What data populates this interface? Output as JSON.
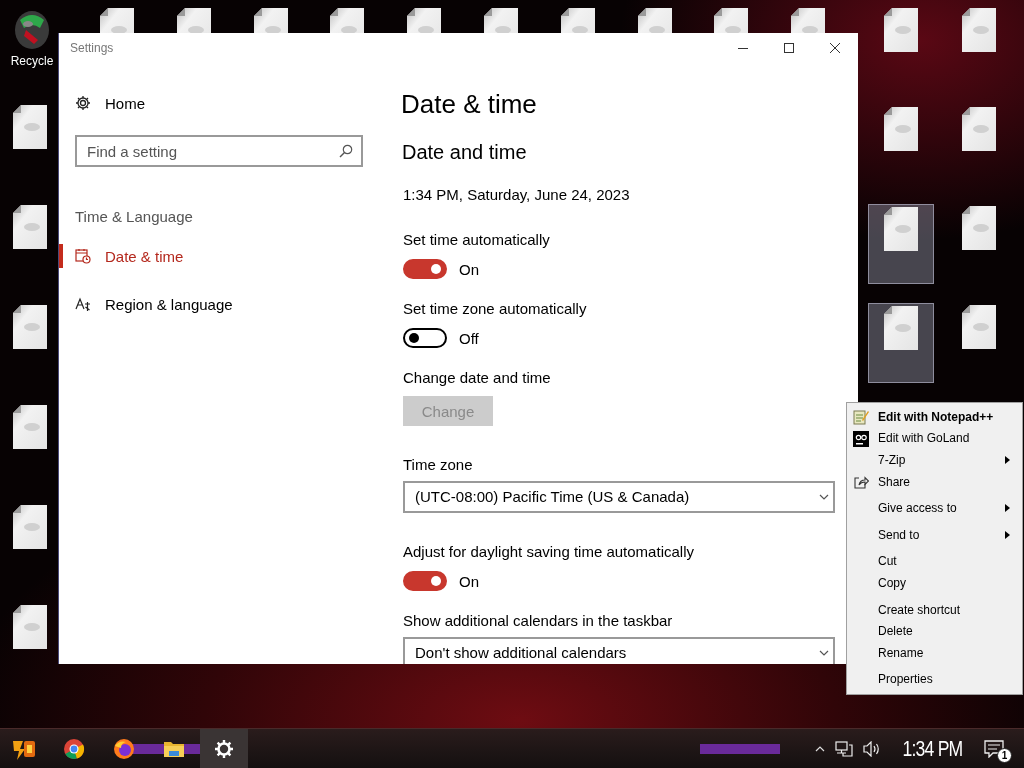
{
  "desktop": {
    "recycle_bin": {
      "label": "Recycle"
    },
    "top_row": [
      {
        "selected": false
      },
      {
        "selected": false
      },
      {
        "selected": false
      },
      {
        "selected": false
      },
      {
        "selected": false
      },
      {
        "selected": false
      },
      {
        "selected": false
      },
      {
        "selected": false
      },
      {
        "selected": false
      },
      {
        "selected": false
      }
    ],
    "left_column": [
      {
        "selected": false
      },
      {
        "selected": false
      },
      {
        "selected": false
      },
      {
        "selected": false
      },
      {
        "selected": false
      },
      {
        "selected": false
      }
    ],
    "right_columns": [
      {
        "selected": false
      },
      {
        "selected": false
      },
      {
        "selected": false
      },
      {
        "selected": false
      },
      {
        "selected": true
      },
      {
        "selected": false
      },
      {
        "selected": true
      },
      {
        "selected": false
      }
    ]
  },
  "settings_window": {
    "title": "Settings",
    "sidebar": {
      "home": "Home",
      "search": {
        "placeholder": "Find a setting"
      },
      "section": "Time & Language",
      "items": [
        {
          "label": "Date & time",
          "selected": true
        },
        {
          "label": "Region & language",
          "selected": false
        }
      ]
    },
    "content": {
      "title": "Date & time",
      "subtitle": "Date and time",
      "current": "1:34 PM, Saturday, June 24, 2023",
      "settings": [
        {
          "kind": "toggle",
          "label": "Set time automatically",
          "on": true,
          "state_text": "On"
        },
        {
          "kind": "toggle",
          "label": "Set time zone automatically",
          "on": false,
          "state_text": "Off"
        },
        {
          "kind": "button",
          "label": "Change date and time",
          "button": "Change",
          "disabled": true
        },
        {
          "kind": "dropdown",
          "label": "Time zone",
          "value": "(UTC-08:00) Pacific Time (US & Canada)"
        },
        {
          "kind": "toggle",
          "label": "Adjust for daylight saving time automatically",
          "on": true,
          "state_text": "On"
        },
        {
          "kind": "dropdown",
          "label": "Show additional calendars in the taskbar",
          "value": "Don't show additional calendars"
        }
      ]
    }
  },
  "context_menu": {
    "groups": [
      [
        {
          "label": "Edit with Notepad++",
          "default": true,
          "submenu": false
        },
        {
          "label": "Edit with GoLand",
          "default": false,
          "submenu": false
        },
        {
          "label": "7-Zip",
          "default": false,
          "submenu": true
        },
        {
          "label": "Share",
          "default": false,
          "submenu": false
        }
      ],
      [
        {
          "label": "Give access to",
          "default": false,
          "submenu": true
        }
      ],
      [
        {
          "label": "Send to",
          "default": false,
          "submenu": true
        }
      ],
      [
        {
          "label": "Cut",
          "default": false,
          "submenu": false
        },
        {
          "label": "Copy",
          "default": false,
          "submenu": false
        }
      ],
      [
        {
          "label": "Create shortcut",
          "default": false,
          "submenu": false
        },
        {
          "label": "Delete",
          "default": false,
          "submenu": false
        },
        {
          "label": "Rename",
          "default": false,
          "submenu": false
        }
      ],
      [
        {
          "label": "Properties",
          "default": false,
          "submenu": false
        }
      ]
    ]
  },
  "taskbar": {
    "apps": [
      {
        "selected": false
      },
      {
        "selected": false
      },
      {
        "selected": false
      },
      {
        "selected": false
      },
      {
        "selected": true
      }
    ],
    "clock": "1:34 PM",
    "notification_count": "1"
  }
}
